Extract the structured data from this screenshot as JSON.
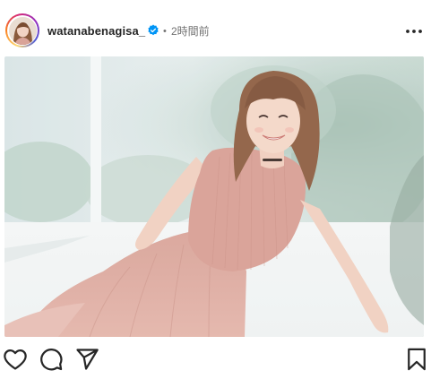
{
  "post": {
    "username": "watanabenagisa_",
    "verified": true,
    "separator": "•",
    "timestamp": "2時間前",
    "image": {
      "subject": "woman-in-pink-sleeveless-knit-dress-sitting-by-window",
      "palette": {
        "background": "#dfe9ea",
        "window_light": "#eef4f4",
        "foliage": "#a9c3b8",
        "dress": "#d9a398",
        "skin": "#f1d2c2",
        "hair": "#8a5a3c"
      }
    }
  },
  "icons": {
    "more": "more-horizontal-icon",
    "verified": "verified-badge-icon",
    "like": "heart-icon",
    "comment": "comment-icon",
    "share": "paper-plane-icon",
    "save": "bookmark-icon"
  },
  "colors": {
    "text": "#262626",
    "muted": "#737373",
    "verified": "#0095f6"
  }
}
